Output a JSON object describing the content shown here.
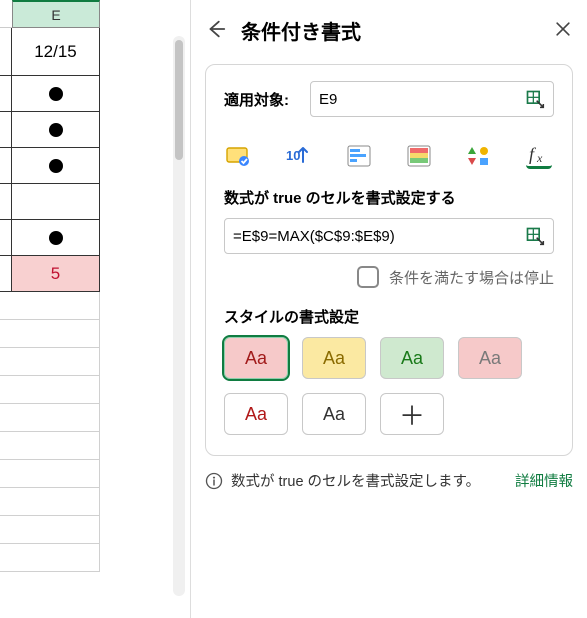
{
  "sheet": {
    "column_label": "E",
    "cells": [
      {
        "type": "text",
        "value": "12/15"
      },
      {
        "type": "dot"
      },
      {
        "type": "dot"
      },
      {
        "type": "dot"
      },
      {
        "type": "blank"
      },
      {
        "type": "dot"
      },
      {
        "type": "highlight",
        "value": "5"
      }
    ]
  },
  "panel": {
    "title": "条件付き書式",
    "applies_to_label": "適用対象:",
    "applies_to_value": "E9",
    "rule_types": [
      {
        "name": "highlight-cells-icon"
      },
      {
        "name": "top-bottom-icon"
      },
      {
        "name": "data-bars-icon"
      },
      {
        "name": "color-scales-icon"
      },
      {
        "name": "icon-sets-icon"
      },
      {
        "name": "formula-icon"
      }
    ],
    "selected_rule_type": 5,
    "formula_section_title": "数式が true のセルを書式設定する",
    "formula_value": "=E$9=MAX($C$9:$E$9)",
    "stop_if_true_label": "条件を満たす場合は停止",
    "stop_if_true_checked": false,
    "style_section_title": "スタイルの書式設定",
    "swatches": [
      {
        "label": "Aa",
        "bg": "#f6c9c9",
        "fg": "#a21b1b",
        "border": "#d99",
        "selected": true
      },
      {
        "label": "Aa",
        "bg": "#fbe9a2",
        "fg": "#8a6b00",
        "selected": false
      },
      {
        "label": "Aa",
        "bg": "#cfe9cf",
        "fg": "#1a7a1a",
        "selected": false
      },
      {
        "label": "Aa",
        "bg": "#f6c9c9",
        "fg": "#7a7a7a",
        "selected": false
      },
      {
        "label": "Aa",
        "bg": "#ffffff",
        "fg": "#b11818",
        "selected": false
      },
      {
        "label": "Aa",
        "bg": "#ffffff",
        "fg": "#333333",
        "selected": false
      }
    ],
    "custom_swatch_label": "＋",
    "info_text": "数式が true のセルを書式設定します。",
    "info_link": "詳細情報"
  }
}
